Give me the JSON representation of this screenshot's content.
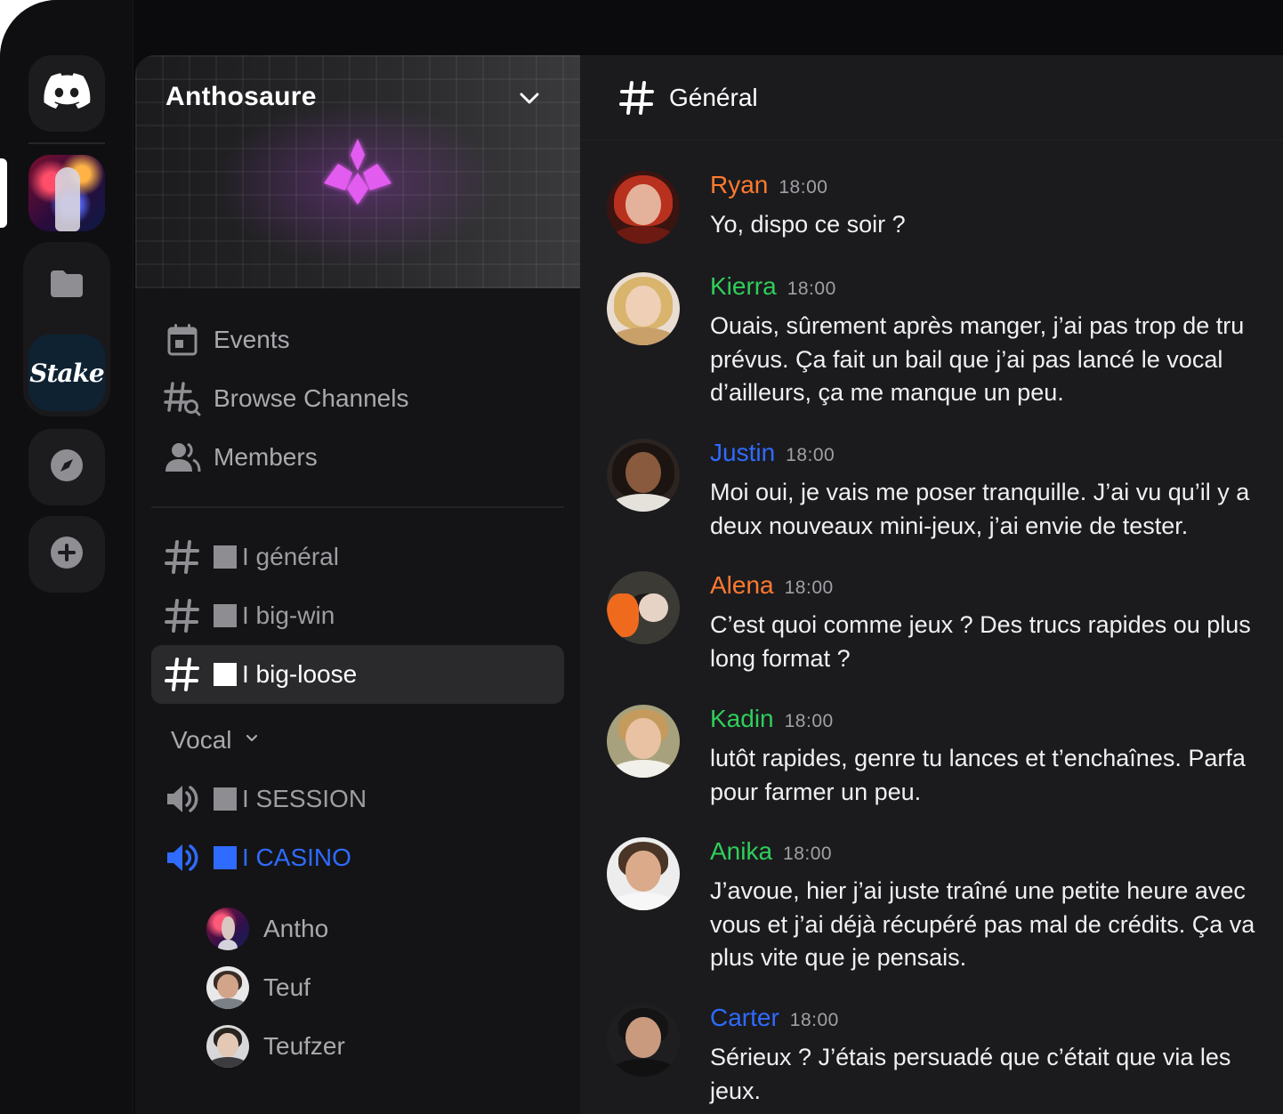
{
  "colors": {
    "accent_blue": "#2f6bff",
    "orange": "#ff7a2f",
    "green": "#2fce5a",
    "blue": "#2f6bff"
  },
  "rail": {
    "icons": [
      "discord-icon",
      "folder-icon",
      "compass-icon",
      "plus-icon"
    ],
    "stake_label": "Stake"
  },
  "server": {
    "name": "Anthosaure"
  },
  "menu": [
    {
      "label": "Events",
      "icon": "calendar-icon"
    },
    {
      "label": "Browse Channels",
      "icon": "browse-channels-icon"
    },
    {
      "label": "Members",
      "icon": "members-icon"
    }
  ],
  "text_channels": [
    {
      "name": "I général",
      "active": false
    },
    {
      "name": "I big-win",
      "active": false
    },
    {
      "name": "I big-loose",
      "active": true
    }
  ],
  "vocal": {
    "label": "Vocal",
    "channels": [
      {
        "name": "I SESSION",
        "active": false
      },
      {
        "name": "I CASINO",
        "active": true
      }
    ],
    "users": [
      "Antho",
      "Teuf",
      "Teufzer"
    ]
  },
  "chat": {
    "channel_title": "Général",
    "messages": [
      {
        "author": "Ryan",
        "color": "#ff7a2f",
        "time": "18:00",
        "lines": [
          " Yo, dispo ce soir ?"
        ]
      },
      {
        "author": "Kierra",
        "color": "#2fce5a",
        "time": "18:00",
        "lines": [
          "Ouais, sûrement après manger, j’ai pas trop de tru",
          "prévus. Ça fait un bail que j’ai pas lancé le vocal",
          "d’ailleurs, ça me manque un peu."
        ]
      },
      {
        "author": "Justin",
        "color": "#2f6bff",
        "time": "18:00",
        "lines": [
          "Moi oui, je vais me poser tranquille. J’ai vu qu’il y a",
          "deux nouveaux mini-jeux, j’ai envie de tester."
        ]
      },
      {
        "author": "Alena",
        "color": "#ff7a2f",
        "time": "18:00",
        "lines": [
          "C’est quoi comme jeux ? Des trucs rapides ou plus",
          "long format ?"
        ]
      },
      {
        "author": "Kadin",
        "color": "#2fce5a",
        "time": "18:00",
        "lines": [
          "lutôt rapides, genre tu lances et t’enchaînes. Parfa",
          "pour farmer un peu."
        ]
      },
      {
        "author": "Anika",
        "color": "#2fce5a",
        "time": "18:00",
        "lines": [
          "J’avoue, hier j’ai juste traîné une petite heure avec",
          "vous et j’ai déjà récupéré pas mal de crédits. Ça va",
          "plus vite que je pensais."
        ]
      },
      {
        "author": "Carter",
        "color": "#2f6bff",
        "time": "18:00",
        "lines": [
          "Sérieux ? J’étais persuadé que c’était que via les",
          "jeux."
        ]
      }
    ]
  }
}
